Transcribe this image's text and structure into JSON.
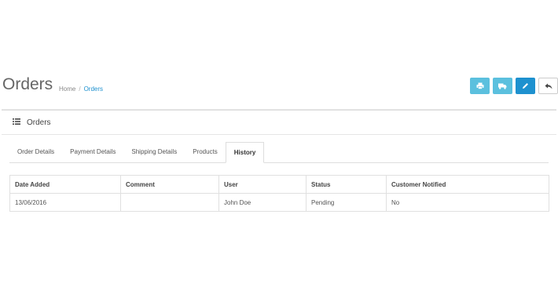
{
  "header": {
    "title": "Orders",
    "breadcrumb": [
      {
        "label": "Home"
      },
      {
        "label": "Orders"
      }
    ],
    "buttons": [
      {
        "icon": "print-icon",
        "color": "#5bc0de"
      },
      {
        "icon": "truck-icon",
        "color": "#5bc0de"
      },
      {
        "icon": "pencil-icon",
        "color": "#1e91cf"
      },
      {
        "icon": "reply-icon",
        "color": "#ffffff"
      }
    ]
  },
  "panel": {
    "title": "Orders",
    "tabs": [
      "Order Details",
      "Payment Details",
      "Shipping Details",
      "Products",
      "History"
    ],
    "active_tab": "History"
  },
  "history_table": {
    "columns": [
      "Date Added",
      "Comment",
      "User",
      "Status",
      "Customer Notified"
    ],
    "rows": [
      [
        "13/06/2016",
        "",
        "John Doe",
        "Pending",
        "No"
      ]
    ]
  }
}
